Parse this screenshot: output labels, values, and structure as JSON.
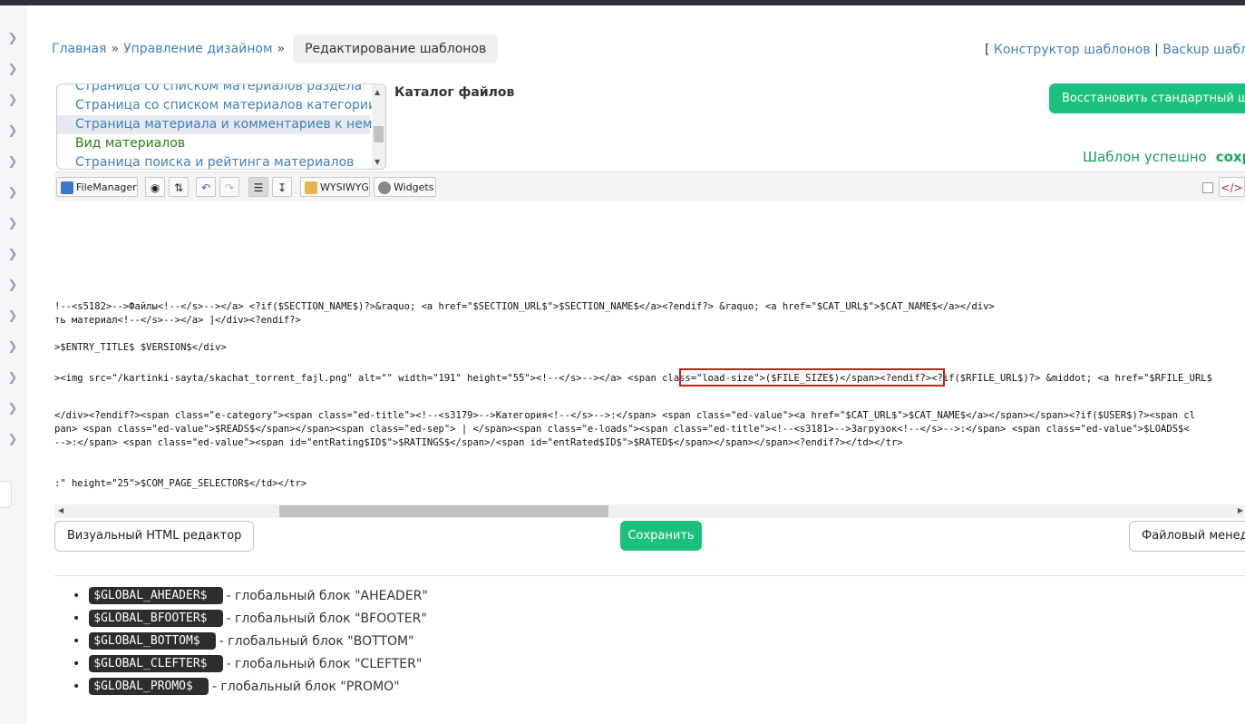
{
  "breadcrumb": {
    "home": "Главная",
    "separator": "»",
    "design": "Управление дизайном",
    "current": "Редактирование шаблонов"
  },
  "header_links": {
    "open_bracket": "[",
    "constructor": "Конструктор шаблонов",
    "separator": "|",
    "backup": "Backup шаблон"
  },
  "templates": {
    "items": [
      "Страница со списком материалов раздела",
      "Страница со списком материалов категории",
      "Страница материала и комментариев к нему",
      "Вид материалов",
      "Страница поиска и рейтинга материалов"
    ],
    "selected_index": 2
  },
  "catalog_label": "Каталог файлов",
  "restore_button": "Восстановить стандартный шабло",
  "status": {
    "text": "Шаблон успешно",
    "bold": "сохран"
  },
  "toolbar": {
    "filemanager": "FileManager",
    "wysiwyg": "WYSIWYG",
    "widgets": "Widgets"
  },
  "code_lines": [
    "!--<s5182>-->Файлы<!--</s>--></a> <?if($SECTION_NAME$)?>&raquo; <a href=\"$SECTION_URL$\">$SECTION_NAME$</a><?endif?> &raquo; <a href=\"$CAT_URL$\">$CAT_NAME$</a></div>",
    "ть материал<!--</s>--></a> ]</div><?endif?>",
    ">$ENTRY_TITLE$ $VERSION$</div>",
    "><img src=\"/kartinki-sayta/skachat_torrent_fajl.png\" alt=\"\" width=\"191\" height=\"55\"><!--</s>--></a> <span class=\"load-size\">($FILE_SIZE$)</span><?endif?><?if($RFILE_URL$)?> &middot; <a href=\"$RFILE_URL$",
    "</div><?endif?><span class=\"e-category\"><span class=\"ed-title\"><!--<s3179>-->Категория<!--</s>-->:</span> <span class=\"ed-value\"><a href=\"$CAT_URL$\">$CAT_NAME$</a></span></span><?if($USER$)?><span cl",
    "pan> <span class=\"ed-value\">$READS$</span></span><span class=\"ed-sep\"> | </span><span class=\"e-loads\"><span class=\"ed-title\"><!--<s3181>-->Загрузок<!--</s>-->:</span> <span class=\"ed-value\">$LOADS$<",
    "-->:</span> <span class=\"ed-value\"><span id=\"entRating$ID$\">$RATINGS$</span>/<span id=\"entRated$ID$\">$RATED$</span></span></span><?endif?></td></tr>",
    ":\" height=\"25\">$COM_PAGE_SELECTOR$</td></tr>"
  ],
  "buttons": {
    "visual_editor": "Визуальный HTML редактор",
    "save": "Сохранить",
    "file_manager": "Файловый менедж"
  },
  "globals": [
    {
      "code": "$GLOBAL_AHEADER$",
      "desc": "- глобальный блок \"AHEADER\""
    },
    {
      "code": "$GLOBAL_BFOOTER$",
      "desc": "- глобальный блок \"BFOOTER\""
    },
    {
      "code": "$GLOBAL_BOTTOM$",
      "desc": "- глобальный блок \"BOTTOM\""
    },
    {
      "code": "$GLOBAL_CLEFTER$",
      "desc": "- глобальный блок \"CLEFTER\""
    },
    {
      "code": "$GLOBAL_PROMO$",
      "desc": "- глобальный блок \"PROMO\""
    }
  ],
  "colors": {
    "accent_green": "#1cc07d",
    "link_blue": "#3f7fc2",
    "highlight_red": "#c81e1e"
  }
}
